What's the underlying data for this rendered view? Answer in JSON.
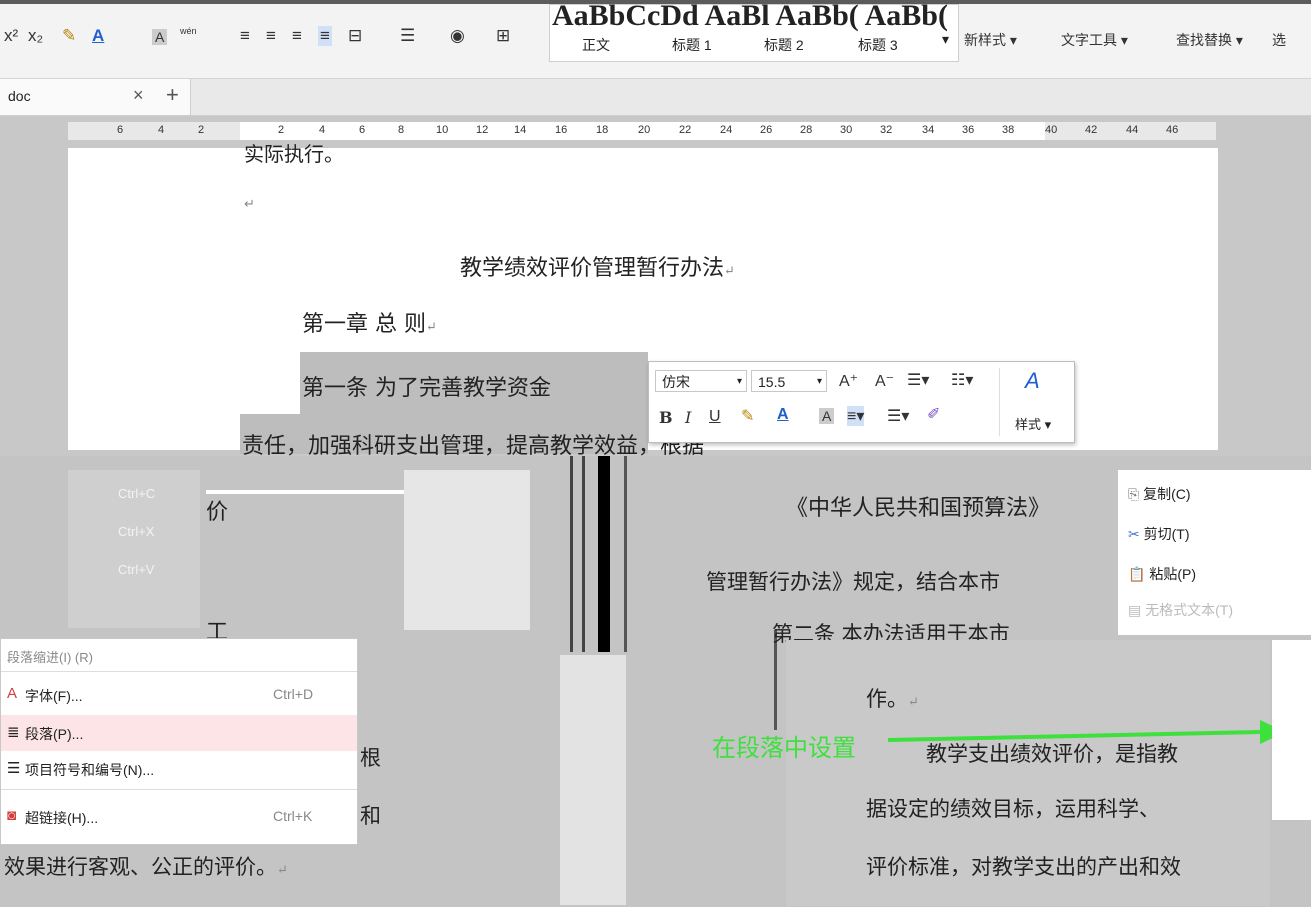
{
  "ribbon": {
    "gallery_preview": "AaBbCcDd AaBl AaBb( AaBb(",
    "style_items": [
      "正文",
      "标题 1",
      "标题 2",
      "标题 3"
    ],
    "new_style": "新样式",
    "text_tools": "文字工具",
    "find_replace": "查找替换",
    "select": "选",
    "superscript": "x²",
    "subscript": "x₂",
    "pinyin": "wén"
  },
  "tab": {
    "title": "doc",
    "close": "×",
    "new": "+"
  },
  "ruler": {
    "left_numbers": [
      "6",
      "4",
      "2"
    ],
    "right_numbers": [
      "2",
      "4",
      "6",
      "8",
      "10",
      "12",
      "14",
      "16",
      "18",
      "20",
      "22",
      "24",
      "26",
      "28",
      "30",
      "32",
      "34",
      "36",
      "38",
      "40",
      "42",
      "44",
      "46"
    ]
  },
  "document": {
    "partial_top": "实际执行。",
    "title": "教学绩效评价管理暂行办法",
    "chapter": "第一章   总   则",
    "article1_start": "第一条   为了完善教学资金",
    "article1_line2": "责任，加强科研支出管理，提高教学效益，根据",
    "law_ref": "《中华人民共和国预算法》",
    "mgmt_ref": "管理暂行办法》规定，结合本市",
    "article2": "第二条   本办法适用于本市",
    "work": "作。",
    "def_line1": "教学支出绩效评价，是指教",
    "def_line2": "据设定的绩效目标，运用科学、",
    "def_line3": "评价标准，对教学支出的产出和效",
    "bottom_left": "效果进行客观、公正的评价。",
    "fragment_jia": "价",
    "fragment_gong": "工",
    "fragment_gen": "根",
    "fragment_he": "和",
    "pilcrow": "↵"
  },
  "mini_toolbar": {
    "font_name": "仿宋",
    "font_size": "15.5",
    "grow": "A⁺",
    "shrink": "A⁻",
    "bold": "B",
    "italic": "I",
    "underline": "U",
    "styles_label": "样式"
  },
  "shortcuts_ghost": [
    "Ctrl+C",
    "Ctrl+X",
    "Ctrl+V"
  ],
  "context_menu": {
    "garbled_header": "段落缩进(I) (R)",
    "items": [
      {
        "label": "字体(F)...",
        "shortcut": "Ctrl+D"
      },
      {
        "label": "段落(P)...",
        "shortcut": ""
      },
      {
        "label": "项目符号和编号(N)...",
        "shortcut": ""
      },
      {
        "label": "超链接(H)...",
        "shortcut": "Ctrl+K"
      }
    ]
  },
  "context_menu_top": {
    "copy": "复制(C)",
    "cut": "剪切(T)",
    "paste": "粘贴(P)",
    "paste_plain": "无格式文本(T)"
  },
  "annotation": {
    "text": "在段落中设置",
    "color": "#3ee03e"
  }
}
